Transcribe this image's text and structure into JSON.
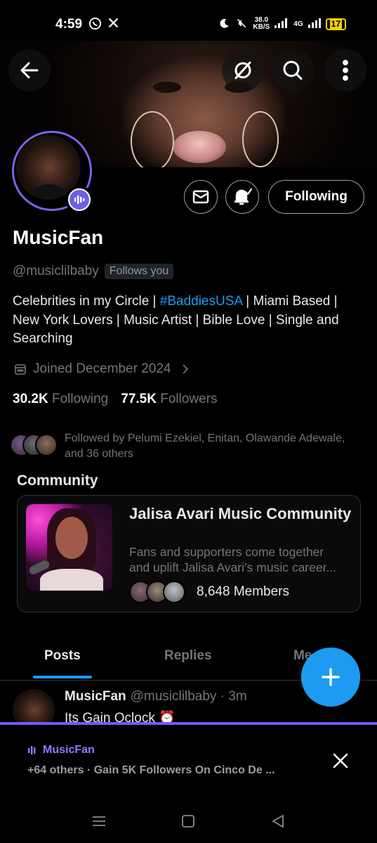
{
  "status_bar": {
    "time": "4:59",
    "left_icons": [
      "whatsapp-icon",
      "x-logo-icon"
    ],
    "speed_value": "38.0",
    "speed_unit": "KB/S",
    "network": "4G",
    "battery": "17"
  },
  "profile": {
    "display_name": "MusicFan",
    "handle": "@musiclilbaby",
    "follows_you": "Follows you",
    "bio_part1": "Celebrities in my Circle | ",
    "bio_hashtag": "#BaddiesUSA",
    "bio_part2": " | Miami Based | New York Lovers | Music Artist | Bible Love | Single and Searching",
    "joined": "Joined December 2024",
    "following_count": "30.2K",
    "following_label": "Following",
    "followers_count": "77.5K",
    "followers_label": "Followers",
    "follow_button": "Following",
    "followed_by": "Followed by Pelumi Ezekiel, Enitan, Olawande Adewale, and 36 others"
  },
  "community": {
    "section_title": "Community",
    "name": "Jalisa Avari Music Community",
    "description_line1": "Fans and supporters come together",
    "description_line2": "and uplift Jalisa Avari’s music career...",
    "members": "8,648 Members"
  },
  "tabs": [
    {
      "label": "Posts",
      "active": true
    },
    {
      "label": "Replies",
      "active": false
    },
    {
      "label": "Me",
      "active": false
    }
  ],
  "post": {
    "author": "MusicFan",
    "handle_time": "@musiclilbaby · 3m",
    "text": "Its Gain Oclock ⏰"
  },
  "spaces": {
    "host": "MusicFan",
    "title": "+64 others · Gain 5K Followers On Cinco De ..."
  },
  "colors": {
    "accent": "#1d9bf0",
    "spaces_purple": "#7856ff",
    "avatar_ring": "#7b63e6"
  }
}
